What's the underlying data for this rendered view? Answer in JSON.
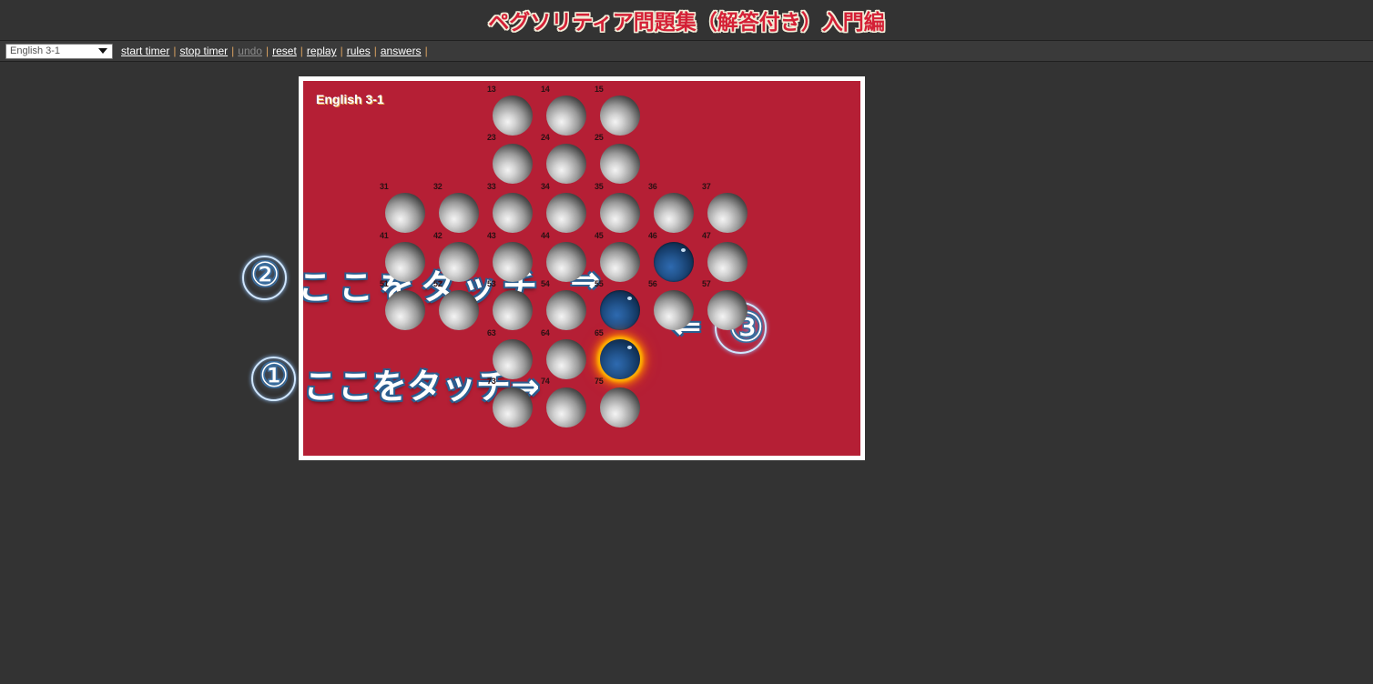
{
  "page": {
    "title": "ペグソリティア問題集（解答付き）入門編",
    "background_color": "#333333",
    "title_color": "#d42036"
  },
  "toolbar": {
    "select": {
      "value": "English 3-1",
      "icon": "chevron-down-icon"
    },
    "links": [
      {
        "label": "start timer",
        "disabled": false
      },
      {
        "label": "stop timer",
        "disabled": false
      },
      {
        "label": "undo",
        "disabled": true
      },
      {
        "label": "reset",
        "disabled": false
      },
      {
        "label": "replay",
        "disabled": false
      },
      {
        "label": "rules",
        "disabled": false
      },
      {
        "label": "answers",
        "disabled": false
      }
    ],
    "separator": "|"
  },
  "board": {
    "label": "English 3-1",
    "board_color": "#b51f35",
    "border_color": "#ffffff",
    "peg_color": "#17406f",
    "hole_color": "#9a9a9a",
    "highlight_color": "#ffb400",
    "cells": [
      {
        "id": "13",
        "col": 3,
        "row": 1,
        "state": "hole"
      },
      {
        "id": "14",
        "col": 4,
        "row": 1,
        "state": "hole"
      },
      {
        "id": "15",
        "col": 5,
        "row": 1,
        "state": "hole"
      },
      {
        "id": "23",
        "col": 3,
        "row": 2,
        "state": "hole"
      },
      {
        "id": "24",
        "col": 4,
        "row": 2,
        "state": "hole"
      },
      {
        "id": "25",
        "col": 5,
        "row": 2,
        "state": "hole"
      },
      {
        "id": "31",
        "col": 1,
        "row": 3,
        "state": "hole"
      },
      {
        "id": "32",
        "col": 2,
        "row": 3,
        "state": "hole"
      },
      {
        "id": "33",
        "col": 3,
        "row": 3,
        "state": "hole"
      },
      {
        "id": "34",
        "col": 4,
        "row": 3,
        "state": "hole"
      },
      {
        "id": "35",
        "col": 5,
        "row": 3,
        "state": "hole"
      },
      {
        "id": "36",
        "col": 6,
        "row": 3,
        "state": "hole"
      },
      {
        "id": "37",
        "col": 7,
        "row": 3,
        "state": "hole"
      },
      {
        "id": "41",
        "col": 1,
        "row": 4,
        "state": "hole"
      },
      {
        "id": "42",
        "col": 2,
        "row": 4,
        "state": "hole"
      },
      {
        "id": "43",
        "col": 3,
        "row": 4,
        "state": "hole"
      },
      {
        "id": "44",
        "col": 4,
        "row": 4,
        "state": "hole"
      },
      {
        "id": "45",
        "col": 5,
        "row": 4,
        "state": "hole"
      },
      {
        "id": "46",
        "col": 6,
        "row": 4,
        "state": "peg"
      },
      {
        "id": "47",
        "col": 7,
        "row": 4,
        "state": "hole"
      },
      {
        "id": "51",
        "col": 1,
        "row": 5,
        "state": "hole"
      },
      {
        "id": "52",
        "col": 2,
        "row": 5,
        "state": "hole"
      },
      {
        "id": "53",
        "col": 3,
        "row": 5,
        "state": "hole"
      },
      {
        "id": "54",
        "col": 4,
        "row": 5,
        "state": "hole"
      },
      {
        "id": "55",
        "col": 5,
        "row": 5,
        "state": "peg"
      },
      {
        "id": "56",
        "col": 6,
        "row": 5,
        "state": "hole"
      },
      {
        "id": "57",
        "col": 7,
        "row": 5,
        "state": "hole"
      },
      {
        "id": "63",
        "col": 3,
        "row": 6,
        "state": "hole"
      },
      {
        "id": "64",
        "col": 4,
        "row": 6,
        "state": "hole"
      },
      {
        "id": "65",
        "col": 5,
        "row": 6,
        "state": "peg-selected"
      },
      {
        "id": "73",
        "col": 3,
        "row": 7,
        "state": "hole"
      },
      {
        "id": "74",
        "col": 4,
        "row": 7,
        "state": "hole"
      },
      {
        "id": "75",
        "col": 5,
        "row": 7,
        "state": "hole"
      }
    ]
  },
  "annotations": {
    "step1": {
      "marker": "①",
      "text": "ここをタッチ⇒"
    },
    "step2": {
      "marker": "②",
      "text": "ここをタッチ",
      "arrow": "⇒"
    },
    "step3": {
      "marker": "③",
      "arrow": "⇐"
    }
  }
}
